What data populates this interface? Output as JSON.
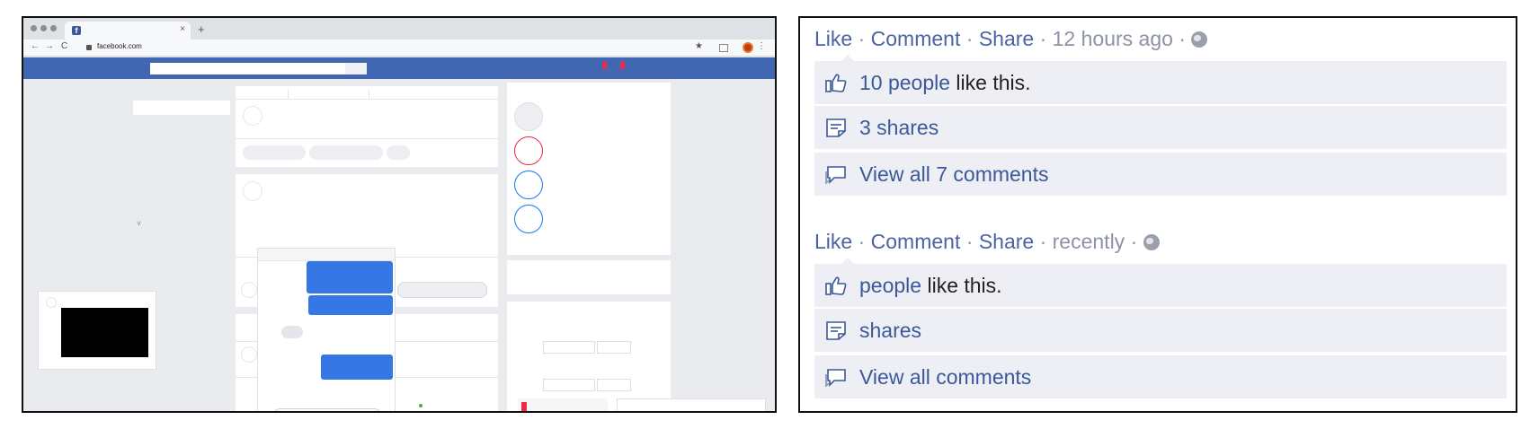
{
  "browser": {
    "url": "facebook.com",
    "tab_close": "×",
    "new_tab": "+",
    "back": "←",
    "forward": "→",
    "reload": "C",
    "bookmark": "★",
    "menu": "⋮",
    "favicon_letter": "f",
    "collapse_caret": "˅"
  },
  "posts": [
    {
      "actions": {
        "like": "Like",
        "comment": "Comment",
        "share": "Share",
        "timestamp": "12 hours ago",
        "separator": "·"
      },
      "likes": {
        "link": "10 people",
        "suffix": " like this."
      },
      "shares": "3 shares",
      "comments": "View all 7 comments"
    },
    {
      "actions": {
        "like": "Like",
        "comment": "Comment",
        "share": "Share",
        "timestamp": "recently",
        "separator": "·"
      },
      "likes": {
        "link": "people",
        "suffix": " like this."
      },
      "shares": "shares",
      "comments": "View all comments"
    }
  ],
  "colors": {
    "facebook_blue": "#4267b2",
    "link_blue": "#3b5998",
    "row_background": "#edeff5",
    "messenger_blue": "#3578e5",
    "notification_red": "#f02849"
  },
  "icons": [
    "thumbs-up-icon",
    "share-icon",
    "comment-icon",
    "globe-icon"
  ]
}
